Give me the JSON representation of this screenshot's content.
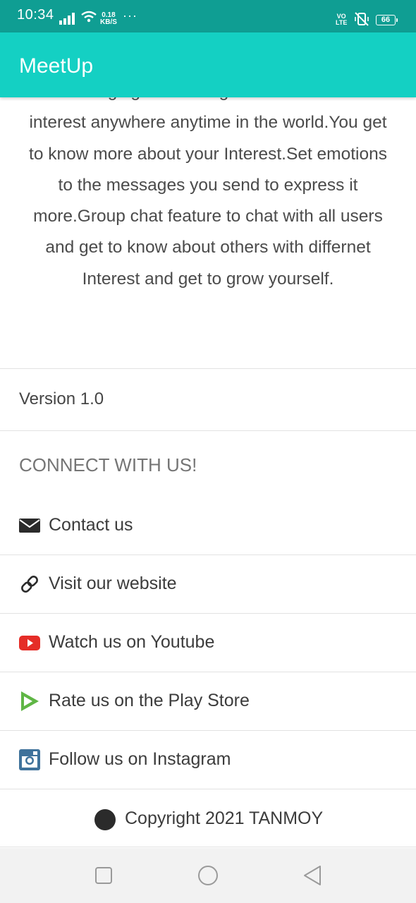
{
  "status": {
    "time": "10:34",
    "net_speed_value": "0.18",
    "net_speed_unit": "KB/S",
    "overflow": "···",
    "volte_top": "VO",
    "volte_bottom": "LTE",
    "battery": "66"
  },
  "app_bar": {
    "title": "MeetUp"
  },
  "about": {
    "description": "Messaging with strangers with common interest anywhere anytime in the world.You get to know more about your Interest.Set emotions to the messages you send to express it more.Group chat feature to chat with all users and get to know about others with differnet Interest and get to grow yourself.",
    "version": "Version 1.0",
    "connect_heading": "CONNECT WITH US!"
  },
  "links": [
    {
      "label": "Contact us",
      "icon": "envelope-icon",
      "color": "#2b2b2b"
    },
    {
      "label": "Visit our website",
      "icon": "link-icon",
      "color": "#2b2b2b"
    },
    {
      "label": "Watch us on Youtube",
      "icon": "youtube-icon",
      "color": "#e52d27"
    },
    {
      "label": "Rate us on the Play Store",
      "icon": "play-store-icon",
      "color": "#5fb645"
    },
    {
      "label": "Follow us on Instagram",
      "icon": "instagram-icon",
      "color": "#3f729b"
    }
  ],
  "copyright": {
    "text": "Copyright 2021 TANMOY"
  },
  "colors": {
    "status_bar": "#0f9e93",
    "app_bar": "#14d0c3"
  }
}
